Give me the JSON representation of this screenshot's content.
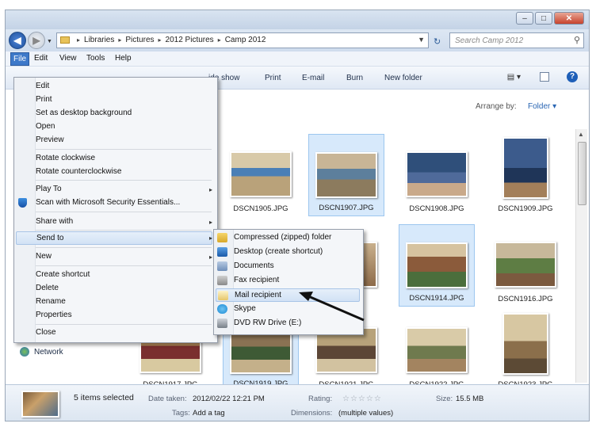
{
  "window": {
    "caption_min": "–",
    "caption_max": "□",
    "caption_close": "✕"
  },
  "address": {
    "crumbs": [
      "Libraries",
      "Pictures",
      "2012 Pictures",
      "Camp 2012"
    ],
    "search_placeholder": "Search Camp 2012"
  },
  "menubar": [
    "File",
    "Edit",
    "View",
    "Tools",
    "Help"
  ],
  "toolbar": {
    "slideshow": "ide show",
    "print": "Print",
    "email": "E-mail",
    "burn": "Burn",
    "new_folder": "New folder"
  },
  "library": {
    "heading": "y",
    "arrange_label": "Arrange by:",
    "arrange_value": "Folder"
  },
  "navpane": {
    "network": "Network"
  },
  "files": [
    {
      "name": "DSCN1905.JPG",
      "selected": false
    },
    {
      "name": "DSCN1907.JPG",
      "selected": true
    },
    {
      "name": "DSCN1908.JPG",
      "selected": false
    },
    {
      "name": "DSCN1909.JPG",
      "selected": false
    },
    {
      "name": "DSCN1914.JPG",
      "selected": true
    },
    {
      "name": "DSCN1916.JPG",
      "selected": false
    },
    {
      "name": "DSCN1917.JPG",
      "selected": false
    },
    {
      "name": "DSCN1919.JPG",
      "selected": true
    },
    {
      "name": "DSCN1921.JPG",
      "selected": false
    },
    {
      "name": "DSCN1922.JPG",
      "selected": false
    },
    {
      "name": "DSCN1923.JPG",
      "selected": false
    }
  ],
  "file_menu": {
    "items": [
      "Edit",
      "Print",
      "Set as desktop background",
      "Open",
      "Preview",
      "Rotate clockwise",
      "Rotate counterclockwise",
      "Play To",
      "Scan with Microsoft Security Essentials...",
      "Share with",
      "Send to",
      "New",
      "Create shortcut",
      "Delete",
      "Rename",
      "Properties",
      "Close"
    ],
    "highlighted": "Send to"
  },
  "send_to": {
    "items": [
      "Compressed (zipped) folder",
      "Desktop (create shortcut)",
      "Documents",
      "Fax recipient",
      "Mail recipient",
      "Skype",
      "DVD RW Drive (E:)"
    ],
    "highlighted": "Mail recipient"
  },
  "details": {
    "selected_count": "5 items selected",
    "date_label": "Date taken:",
    "date_value": "2012/02/22 12:21 PM",
    "tags_label": "Tags:",
    "tags_value": "Add a tag",
    "rating_label": "Rating:",
    "rating_stars": "☆☆☆☆☆",
    "dimensions_label": "Dimensions:",
    "dimensions_value": "(multiple values)",
    "size_label": "Size:",
    "size_value": "15.5 MB"
  },
  "colors": {
    "accent": "#3e79c9",
    "selection": "#d7e9fb",
    "menu_highlight": "#d2e2f5"
  }
}
